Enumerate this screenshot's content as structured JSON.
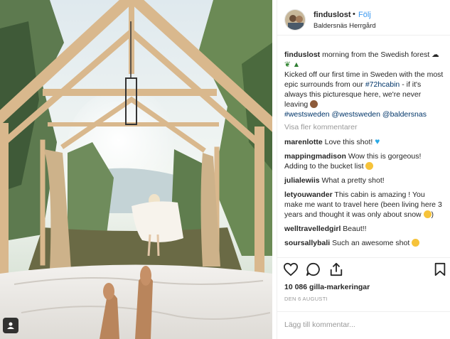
{
  "post": {
    "username": "finduslost",
    "separator": "•",
    "follow_label": "Följ",
    "location": "Baldersnäs Herrgård",
    "caption": {
      "username": "finduslost",
      "line1": "morning from the Swedish forest",
      "line2_prefix": "Kicked off our first time in Sweden with the most epic surrounds from our ",
      "hashtag1": "#72hcabin",
      "line2_suffix": " - if it's always this picturesque here, we're never leaving",
      "hashtag2": "#westsweden",
      "mention1": "@westsweden",
      "mention2": "@baldersnas"
    },
    "view_more_label": "Visa fler kommentarer",
    "comments": [
      {
        "user": "marenlotte",
        "text": "Love this shot!",
        "emoji": "blue-heart"
      },
      {
        "user": "mappingmadison",
        "text": "Wow this is gorgeous! Adding to the bucket list",
        "emoji": "hugging-face"
      },
      {
        "user": "julialewiis",
        "text": "What a pretty shot!",
        "emoji": ""
      },
      {
        "user": "letyouwander",
        "text": "This cabin is amazing ! You make me want to travel here (been living here 3 years and thought it was only about snow",
        "emoji": "tongue-face",
        "suffix": ")"
      },
      {
        "user": "welltravelledgirl",
        "text": "Beaut!!",
        "emoji": ""
      },
      {
        "user": "soursallybali",
        "text": "Such an awesome shot",
        "emoji": "heart-eyes"
      }
    ],
    "likes": "10 086 gilla-markeringar",
    "date": "DEN 6 AUGUSTI",
    "add_comment_placeholder": "Lägg till kommentar..."
  },
  "colors": {
    "link": "#003569",
    "follow": "#3897f0",
    "muted": "#999999"
  },
  "icons": [
    "heart-icon",
    "comment-icon",
    "share-icon",
    "bookmark-icon",
    "user-tag-icon"
  ]
}
